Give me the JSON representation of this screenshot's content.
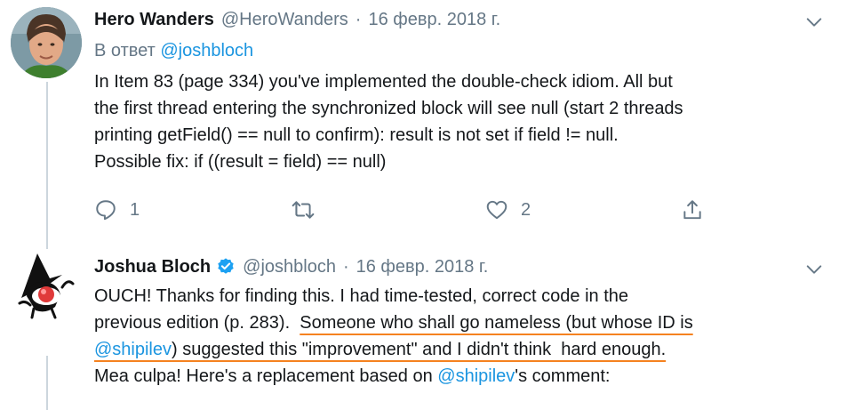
{
  "tweet1": {
    "name": "Hero Wanders",
    "handle": "@HeroWanders",
    "separator": "·",
    "date": "16 февр. 2018 г.",
    "reply_prefix": "В ответ",
    "reply_handle": "@joshbloch",
    "lines": [
      "In Item 83 (page 334) you've implemented the double-check idiom. All but",
      "the first thread entering the synchronized block will see null (start 2 threads",
      "printing getField() == null to confirm): result is not set if field != null.",
      "Possible fix: if ((result = field) == null)"
    ],
    "reply_count": "1",
    "retweet_count": "",
    "like_count": "2"
  },
  "tweet2": {
    "name": "Joshua Bloch",
    "handle": "@joshbloch",
    "separator": "·",
    "date": "16 февр. 2018 г.",
    "line1": "OUCH! Thanks for finding this. I had time-tested, correct code in the",
    "line2_a": "previous edition (p. 283).  ",
    "line2_b": "Someone who shall go nameless (but whose ID is",
    "line3_mention": "@shipilev",
    "line3_b": ") suggested this \"improvement\" and I didn't think  hard enough.",
    "line4_a": "Mea culpa! Here's a replacement based on ",
    "line4_mention": "@shipilev",
    "line4_b": "'s comment:"
  },
  "colors": {
    "link": "#1b95e0",
    "muted": "#657786",
    "text": "#14171a",
    "underline": "#f58220",
    "verified": "#1da1f2"
  }
}
